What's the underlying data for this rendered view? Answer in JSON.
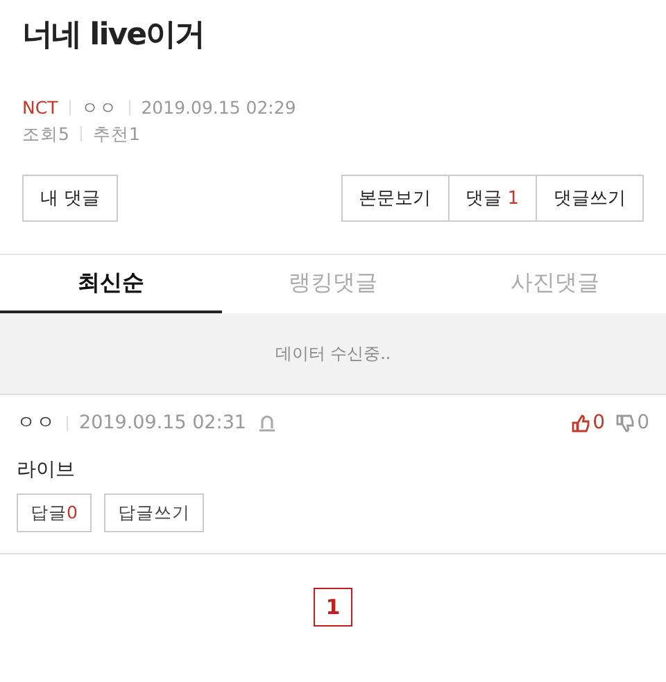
{
  "post": {
    "title": "너네 live이거",
    "board": "NCT",
    "author": "ㅇㅇ",
    "date": "2019.09.15 02:29",
    "views": "조회5",
    "recommends": "추천1"
  },
  "actions": {
    "my_comments": "내 댓글",
    "view_post": "본문보기",
    "comments_label": "댓글",
    "comments_count": "1",
    "write_comment": "댓글쓰기"
  },
  "tabs": [
    {
      "label": "최신순",
      "selected": true
    },
    {
      "label": "랭킹댓글",
      "selected": false
    },
    {
      "label": "사진댓글",
      "selected": false
    }
  ],
  "loading": "데이터 수신중..",
  "comments": [
    {
      "author": "ㅇㅇ",
      "date": "2019.09.15 02:31",
      "likes": "0",
      "dislikes": "0",
      "text": "라이브",
      "replies_label": "답글",
      "replies_count": "0",
      "write_reply": "답글쓰기"
    }
  ],
  "pagination": [
    {
      "label": "1",
      "selected": true
    }
  ]
}
